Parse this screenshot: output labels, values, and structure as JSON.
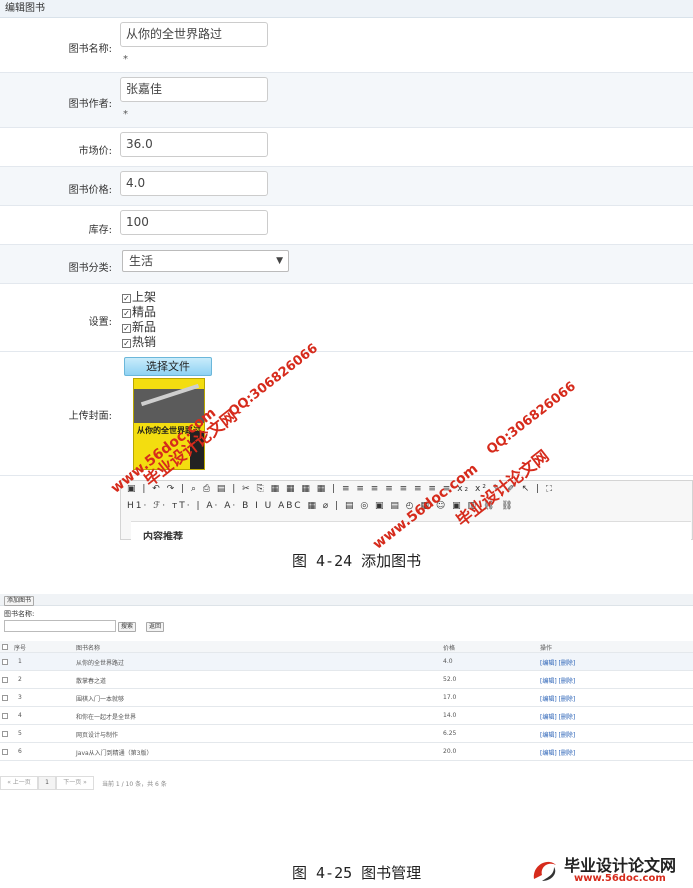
{
  "edit_form": {
    "header": "编辑图书",
    "fields": {
      "title": {
        "label": "图书名称:",
        "value": "从你的全世界路过",
        "required_mark": "*"
      },
      "author": {
        "label": "图书作者:",
        "value": "张嘉佳",
        "required_mark": "*"
      },
      "market_price": {
        "label": "市场价:",
        "value": "36.0"
      },
      "price": {
        "label": "图书价格:",
        "value": "4.0"
      },
      "stock": {
        "label": "库存:",
        "value": "100"
      },
      "category": {
        "label": "图书分类:",
        "value": "生活"
      },
      "settings": {
        "label": "设置:",
        "options": [
          {
            "label": "上架",
            "checked": true
          },
          {
            "label": "精品",
            "checked": true
          },
          {
            "label": "新品",
            "checked": true
          },
          {
            "label": "热销",
            "checked": true
          }
        ]
      },
      "cover": {
        "label": "上传封面:",
        "button": "选择文件"
      }
    },
    "editor": {
      "toolbar_row1": "▣ | ↶ ↷ | ⌕ ⎙ ▤ | ✂ ⎘ ▦ ▦ ▦ ▦ | ≡ ≡ ≡ ≡ ≡ ≡ ≡ ≡ x₂ x² ✎ ✐ ↖ | ⛶",
      "toolbar_row2": "H1· ℱ· ᴛT· | A· A· B I U ABC ▦ ⌀ | ▤ ◎ ▣ ▤ ◴ ▦ ☺ ▣ ▥ ⛓ ⛓",
      "content_heading": "内容推荐"
    },
    "caption": "图 4-24 添加图书"
  },
  "list_page": {
    "add_button": "添加图书",
    "search_label": "图书名称:",
    "search_button": "搜索",
    "back_button": "返回",
    "columns": [
      "序号",
      "图书名称",
      "价格",
      "操作"
    ],
    "rows": [
      {
        "no": "1",
        "name": "从你的全世界路过",
        "price": "4.0",
        "ops": "[编辑] [删除]"
      },
      {
        "no": "2",
        "name": "散掌春之道",
        "price": "52.0",
        "ops": "[编辑] [删除]"
      },
      {
        "no": "3",
        "name": "围棋入门一本就够",
        "price": "17.0",
        "ops": "[编辑] [删除]"
      },
      {
        "no": "4",
        "name": "和你在一起才是全世界",
        "price": "14.0",
        "ops": "[编辑] [删除]"
      },
      {
        "no": "5",
        "name": "网页设计与制作",
        "price": "6.25",
        "ops": "[编辑] [删除]"
      },
      {
        "no": "6",
        "name": "Java从入门到精通（第3版）",
        "price": "20.0",
        "ops": "[编辑] [删除]"
      }
    ],
    "pager": {
      "prev": "« 上一页",
      "page": "1",
      "next": "下一页 »",
      "status": "当前  1  /  10  条，共 6 条"
    },
    "caption": "图 4-25 图书管理"
  },
  "watermarks": {
    "site_red": "www.56doc.com",
    "qq_red": "QQ:306826066",
    "brand_red": "毕业设计论文网",
    "site": "www.56doc.com",
    "brand": "毕业设计论文网",
    "color": "#d62b1c"
  },
  "cover_title": "从你的全世界路过"
}
